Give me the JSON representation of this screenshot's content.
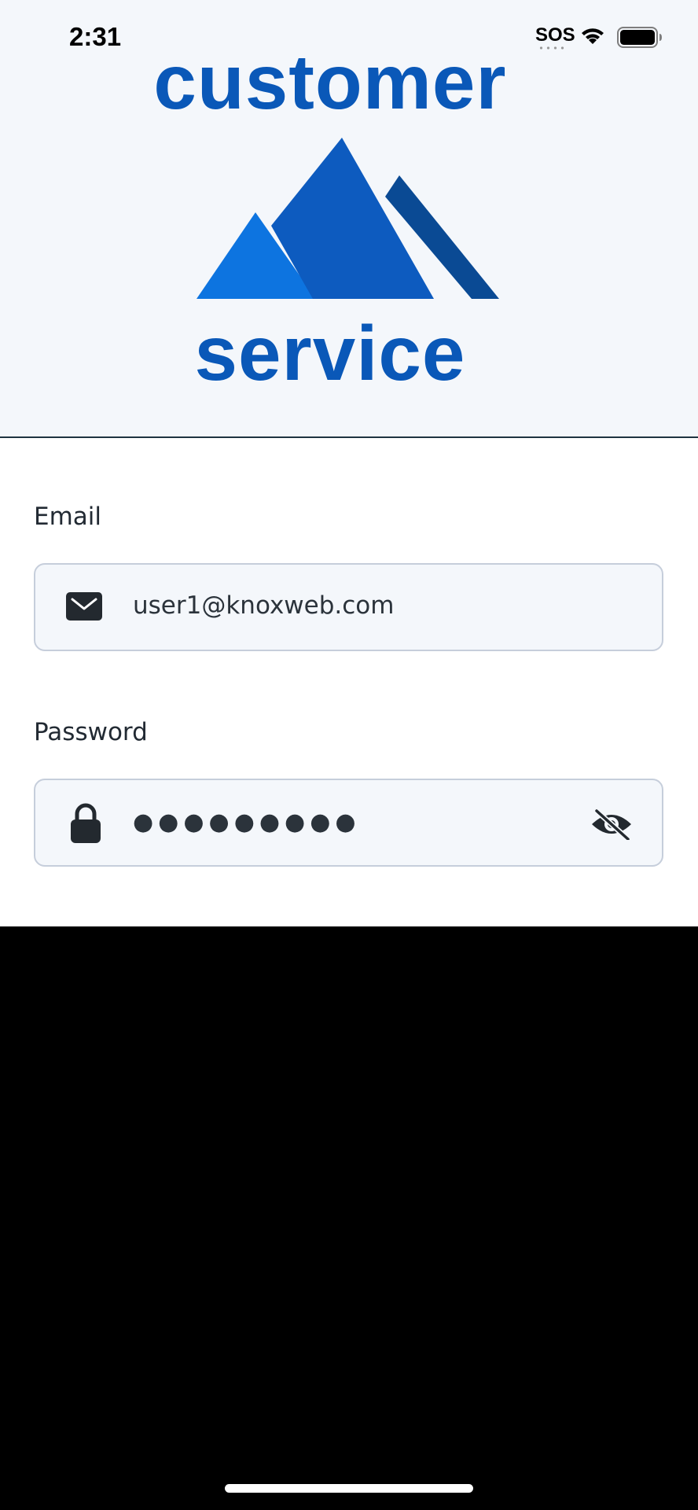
{
  "status_bar": {
    "time": "2:31",
    "sos": "SOS",
    "wifi_icon": "wifi-icon",
    "battery_icon": "battery-full-icon"
  },
  "logo": {
    "top_word": "customer",
    "bottom_word": "service",
    "colors": {
      "text": "#0a58b8",
      "mountain_light": "#0d74e0",
      "mountain_mid": "#0d5bbf",
      "mountain_dark": "#0a4a94"
    }
  },
  "form": {
    "email": {
      "label": "Email",
      "value": "user1@knoxweb.com",
      "icon": "envelope-icon"
    },
    "password": {
      "label": "Password",
      "value": "●●●●●●●●●",
      "icon": "lock-icon",
      "toggle_icon": "eye-slash-icon"
    }
  },
  "colors": {
    "header_background": "#f4f7fb",
    "field_background": "#f4f7fb",
    "field_border": "#c6cedb",
    "text": "#222a33",
    "page_background": "#000000"
  }
}
